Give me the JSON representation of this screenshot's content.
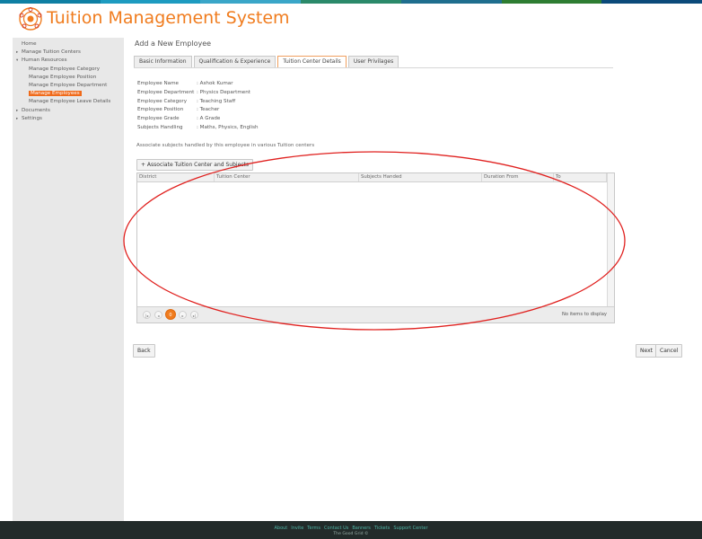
{
  "app": {
    "title": "Tuition Management System"
  },
  "topbar_colors": [
    "#0e7fa3",
    "#1d9bc0",
    "#3aa6c8",
    "#2b8a6a",
    "#1f6e8e",
    "#2e7d32",
    "#0b4a7a"
  ],
  "sidebar": {
    "items": [
      {
        "label": "Home",
        "level": 1,
        "arrow": "",
        "active": false
      },
      {
        "label": "Manage Tuition Centers",
        "level": 1,
        "arrow": "▸",
        "active": false
      },
      {
        "label": "Human Resources",
        "level": 1,
        "arrow": "▾",
        "active": false
      },
      {
        "label": "Manage Employee Category",
        "level": 2,
        "arrow": "",
        "active": false
      },
      {
        "label": "Manage Employee Position",
        "level": 2,
        "arrow": "",
        "active": false
      },
      {
        "label": "Manage Employee Department",
        "level": 2,
        "arrow": "",
        "active": false
      },
      {
        "label": "Manage Employees",
        "level": 2,
        "arrow": "",
        "active": true
      },
      {
        "label": "Manage Employee Leave Details",
        "level": 2,
        "arrow": "",
        "active": false
      },
      {
        "label": "Documents",
        "level": 1,
        "arrow": "▸",
        "active": false
      },
      {
        "label": "Settings",
        "level": 1,
        "arrow": "▸",
        "active": false
      }
    ]
  },
  "page": {
    "title": "Add a New Employee"
  },
  "tabs": [
    {
      "label": "Basic Information",
      "active": false
    },
    {
      "label": "Qualification & Experience",
      "active": false
    },
    {
      "label": "Tuition Center Details",
      "active": true
    },
    {
      "label": "User Privilages",
      "active": false
    }
  ],
  "employee": {
    "rows": [
      {
        "key": "Employee Name",
        "value": ":  Ashok Kumar"
      },
      {
        "key": "Employee Department",
        "value": ":  Physics Department"
      },
      {
        "key": "Employee Category",
        "value": ":  Teaching Staff"
      },
      {
        "key": "Employee Position",
        "value": ":  Teacher"
      },
      {
        "key": "Employee Grade",
        "value": ":  A Grade"
      },
      {
        "key": "Subjects Handling",
        "value": ":  Maths, Physics, English"
      }
    ]
  },
  "association": {
    "text": "Associate subjects handled by this employee in various Tuition centers",
    "button_label": "+ Associate Tuition Center and Subjects"
  },
  "grid": {
    "columns": [
      "District",
      "Tuition Center",
      "Subjects Handed",
      "Duration From",
      "To"
    ],
    "empty_message": "No items to display",
    "pager": {
      "first": "|◂",
      "prev": "◂",
      "current": "0",
      "next": "▸",
      "last": "▸|"
    }
  },
  "actions": {
    "back": "Back",
    "next": "Next",
    "cancel": "Cancel"
  },
  "footer": {
    "links": [
      "About",
      "Invite",
      "Terms",
      "Contact Us",
      "Banners",
      "Tickets",
      "Support Center"
    ],
    "copyright": "The Good Grid ©"
  },
  "annotation": {
    "color": "#e0201e"
  }
}
